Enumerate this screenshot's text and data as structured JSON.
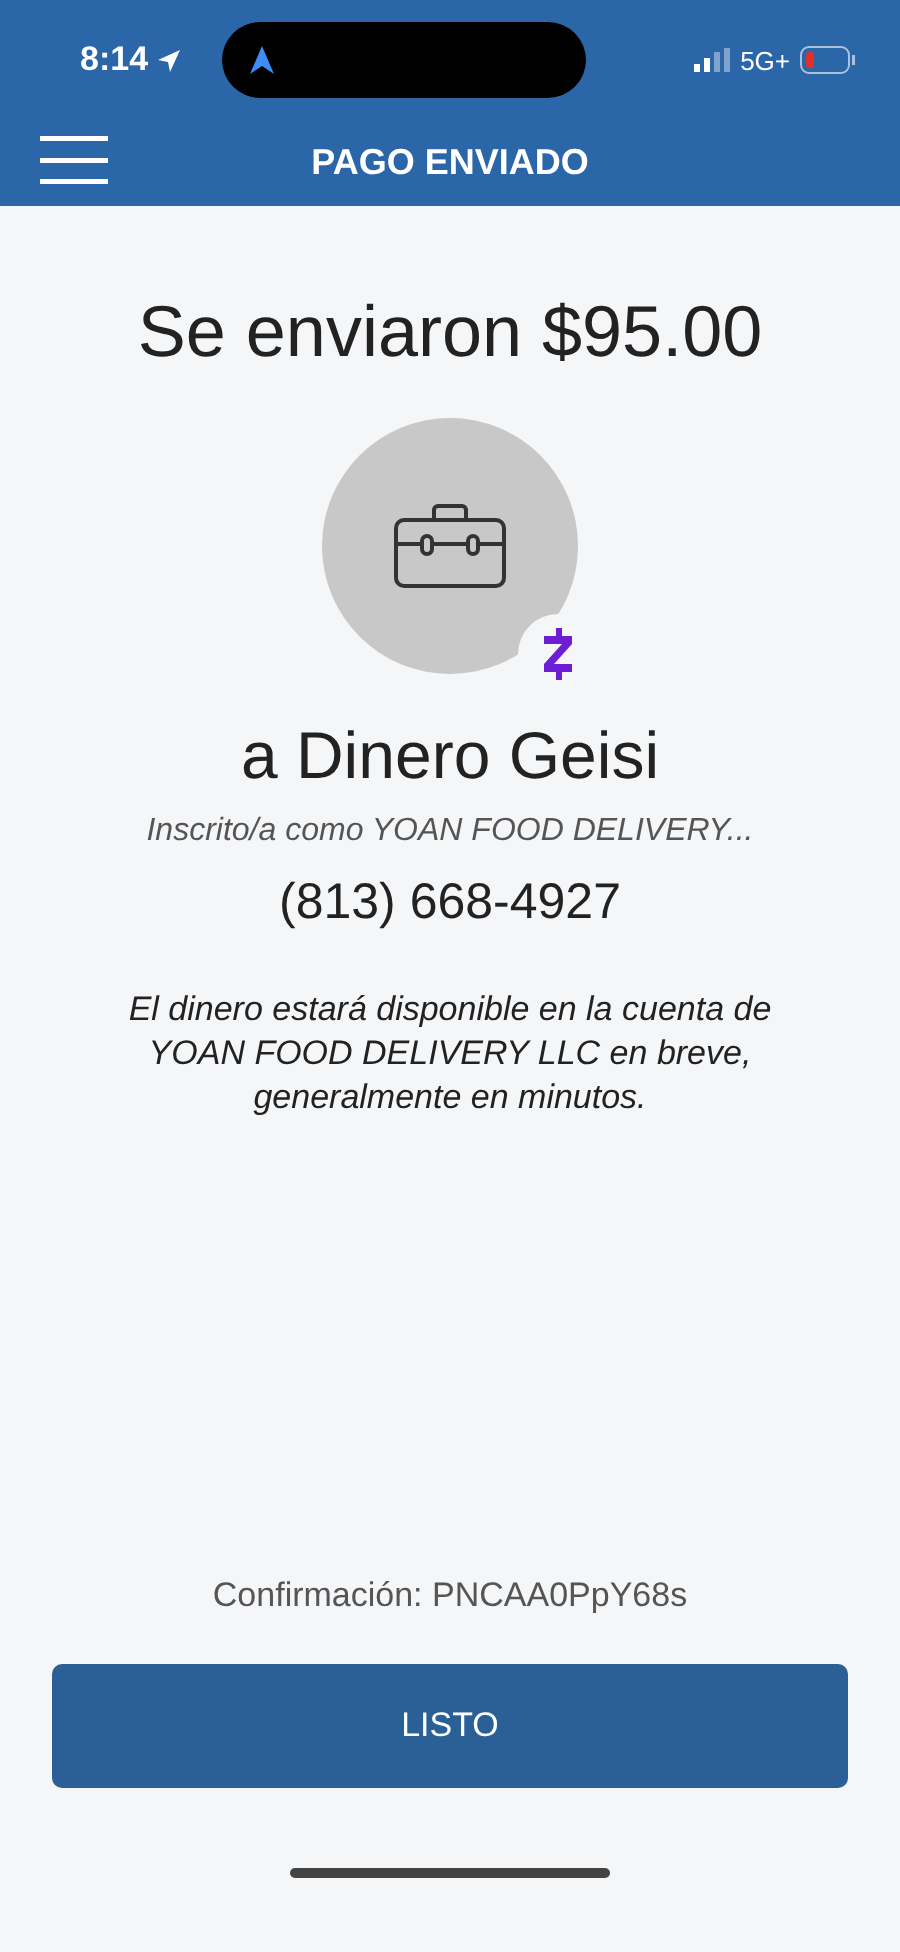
{
  "status_bar": {
    "time": "8:14",
    "network": "5G+"
  },
  "header": {
    "title": "PAGO ENVIADO"
  },
  "payment": {
    "headline": "Se enviaron $95.00",
    "recipient": "a Dinero Geisi",
    "enrolled_as": "Inscrito/a como YOAN FOOD DELIVERY...",
    "phone": "(813) 668-4927",
    "message": "El dinero estará disponible en la cuenta de YOAN FOOD DELIVERY LLC en breve, generalmente en minutos."
  },
  "confirmation": "Confirmación: PNCAA0PpY68s",
  "buttons": [
    {
      "label": "LISTO"
    }
  ]
}
